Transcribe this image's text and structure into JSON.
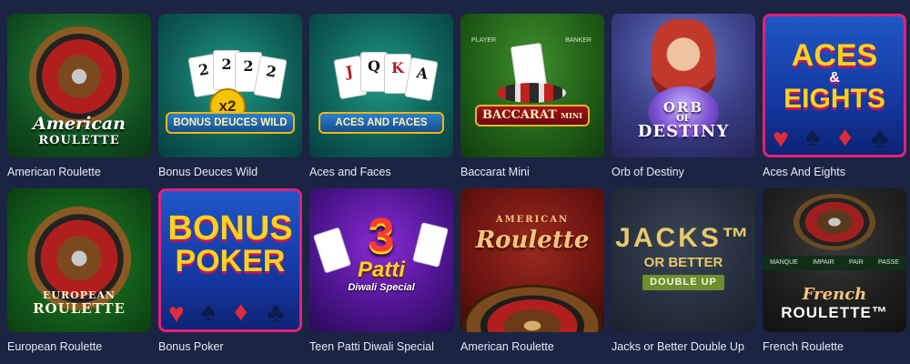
{
  "games": [
    {
      "title": "American Roulette",
      "logo_top": "American",
      "logo_bottom": "ROULETTE"
    },
    {
      "title": "Bonus Deuces Wild",
      "logo_top": "BONUS DEUCES WILD",
      "logo_bottom": "x2",
      "cards": [
        "2",
        "2",
        "2",
        "2"
      ]
    },
    {
      "title": "Aces and Faces",
      "logo_top": "ACES AND FACES",
      "cards": [
        "J",
        "Q",
        "K",
        "A"
      ]
    },
    {
      "title": "Baccarat Mini",
      "logo_top": "BACCARAT",
      "logo_bottom": "MINI",
      "table_labels": [
        "PLAYER",
        "BANKER"
      ]
    },
    {
      "title": "Orb of Destiny",
      "logo_top": "ORB",
      "logo_mid": "OF",
      "logo_bottom": "DESTINY"
    },
    {
      "title": "Aces And Eights",
      "logo_top": "ACES",
      "logo_mid": "&",
      "logo_bottom": "EIGHTS"
    },
    {
      "title": "European Roulette",
      "logo_top": "EUROPEAN",
      "logo_bottom": "ROULETTE"
    },
    {
      "title": "Bonus Poker",
      "logo_top": "BONUS",
      "logo_bottom": "POKER"
    },
    {
      "title": "Teen Patti Diwali Special",
      "logo_top": "3",
      "logo_mid": "Patti",
      "logo_bottom": "Diwali Special"
    },
    {
      "title": "American Roulette",
      "logo_top": "AMERICAN",
      "logo_bottom": "Roulette"
    },
    {
      "title": "Jacks or Better Double Up",
      "logo_top": "JACKS™",
      "logo_mid": "OR BETTER",
      "logo_bottom": "DOUBLE UP"
    },
    {
      "title": "French Roulette",
      "logo_top": "French",
      "logo_bottom": "ROULETTE™",
      "table_labels": [
        "MANQUE",
        "IMPAIR",
        "PAIR",
        "PASSE"
      ]
    }
  ]
}
